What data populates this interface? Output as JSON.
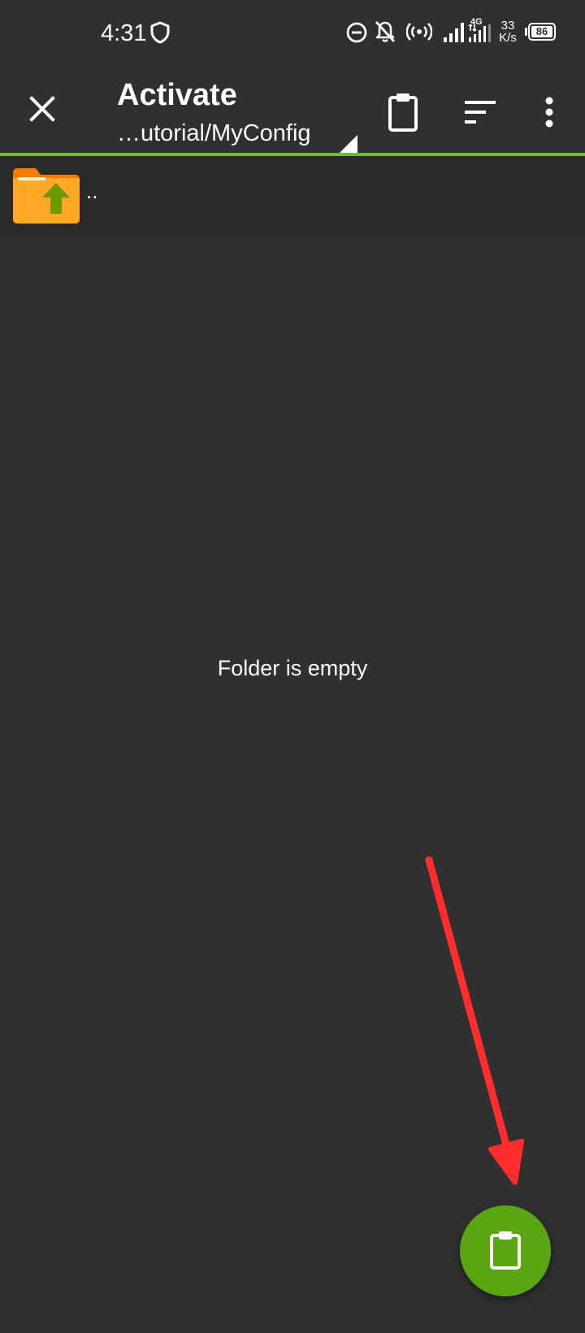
{
  "status_bar": {
    "time": "4:31",
    "network_speed_value": "33",
    "network_speed_unit": "K/s",
    "network_type": "4G",
    "battery_level": "86",
    "icons": [
      "shield-icon",
      "dnd-icon",
      "bell-off-icon",
      "hotspot-icon",
      "signal-icon",
      "signal-4g-icon",
      "battery-icon"
    ]
  },
  "app_bar": {
    "title": "Activate",
    "path": "…utorial/MyConfig",
    "icons": [
      "close-icon",
      "clipboard-icon",
      "sort-icon",
      "more-vert-icon"
    ]
  },
  "file_list": {
    "parent_label": "..",
    "parent_icon": "folder-up-icon",
    "empty_message": "Folder is empty"
  },
  "fab": {
    "icon": "clipboard-icon"
  },
  "colors": {
    "background": "#303030",
    "accent": "#6cbf2a",
    "fab": "#5aa512",
    "folder": "#ffa726",
    "annotation_arrow": "#ff2d2d"
  }
}
